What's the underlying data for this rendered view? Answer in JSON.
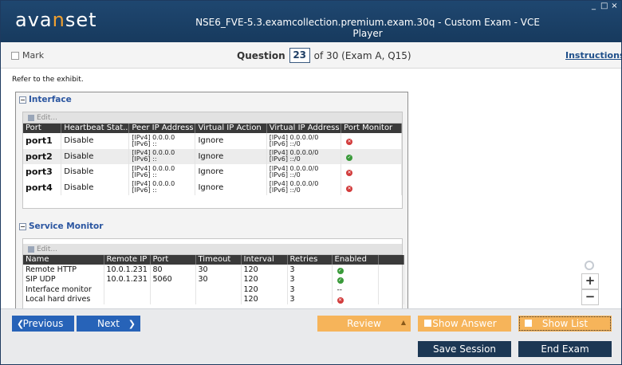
{
  "app": {
    "logo": {
      "pre": "ava",
      "n": "n",
      "post": "set"
    },
    "window_title": "NSE6_FVE-5.3.examcollection.premium.exam.30q - Custom Exam - VCE Player",
    "window_controls": [
      "_",
      "□",
      "×"
    ]
  },
  "question_bar": {
    "mark_label": "Mark",
    "question_label": "Question",
    "question_number": "23",
    "question_suffix": "of 30 (Exam A, Q15)",
    "instructions_label": "Instructions"
  },
  "content": {
    "prompt": "Refer to the exhibit.",
    "interface": {
      "title": "Interface",
      "edit_label": "Edit...",
      "columns": [
        "Port",
        "Heartbeat Stat...",
        "Peer IP Address",
        "Virtual IP Action",
        "Virtual IP Address",
        "Port Monitor"
      ],
      "rows": [
        {
          "port": "port1",
          "heartbeat": "Disable",
          "peer_v4": "[IPv4] 0.0.0.0",
          "peer_v6": "[IPv6] ::",
          "vip_action": "Ignore",
          "vip_v4": "[IPv4] 0.0.0.0/0",
          "vip_v6": "[IPv6] ::/0",
          "monitor": "off"
        },
        {
          "port": "port2",
          "heartbeat": "Disable",
          "peer_v4": "[IPv4] 0.0.0.0",
          "peer_v6": "[IPv6] ::",
          "vip_action": "Ignore",
          "vip_v4": "[IPv4] 0.0.0.0/0",
          "vip_v6": "[IPv6] ::/0",
          "monitor": "on"
        },
        {
          "port": "port3",
          "heartbeat": "Disable",
          "peer_v4": "[IPv4] 0.0.0.0",
          "peer_v6": "[IPv6] ::",
          "vip_action": "Ignore",
          "vip_v4": "[IPv4] 0.0.0.0/0",
          "vip_v6": "[IPv6] ::/0",
          "monitor": "off"
        },
        {
          "port": "port4",
          "heartbeat": "Disable",
          "peer_v4": "[IPv4] 0.0.0.0",
          "peer_v6": "[IPv6] ::",
          "vip_action": "Ignore",
          "vip_v4": "[IPv4] 0.0.0.0/0",
          "vip_v6": "[IPv6] ::/0",
          "monitor": "off"
        }
      ]
    },
    "service_monitor": {
      "title": "Service Monitor",
      "edit_label": "Edit...",
      "columns": [
        "Name",
        "Remote IP",
        "Port",
        "Timeout",
        "Interval",
        "Retries",
        "Enabled"
      ],
      "rows": [
        {
          "name": "Remote HTTP",
          "ip": "10.0.1.231",
          "port": "80",
          "timeout": "30",
          "interval": "120",
          "retries": "3",
          "enabled": "on"
        },
        {
          "name": "SIP UDP",
          "ip": "10.0.1.231",
          "port": "5060",
          "timeout": "30",
          "interval": "120",
          "retries": "3",
          "enabled": "on"
        },
        {
          "name": "Interface monitor",
          "ip": "",
          "port": "",
          "timeout": "",
          "interval": "120",
          "retries": "3",
          "enabled": "--"
        },
        {
          "name": "Local hard drives",
          "ip": "",
          "port": "",
          "timeout": "",
          "interval": "120",
          "retries": "3",
          "enabled": "off"
        }
      ]
    },
    "zoom": {
      "in": "+",
      "out": "−"
    }
  },
  "footer": {
    "previous_label": "Previous",
    "next_label": "Next",
    "review_label": "Review",
    "show_answer_label": "Show Answer",
    "show_list_label": "Show List",
    "save_session_label": "Save Session",
    "end_exam_label": "End Exam"
  },
  "colors": {
    "header": "#1f4770",
    "nav_button": "#2763b8",
    "orange_button": "#f6b45a",
    "dark_button": "#1c3754",
    "section_title": "#2a55a0"
  }
}
